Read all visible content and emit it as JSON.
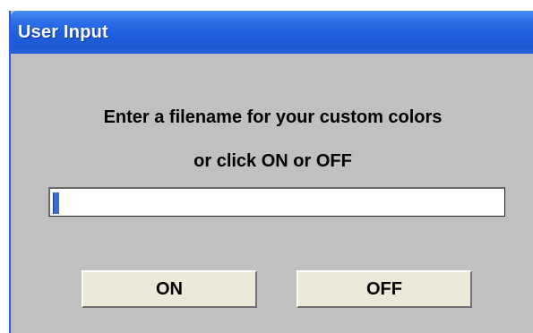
{
  "window": {
    "title": "User Input"
  },
  "dialog": {
    "prompt_line1": "Enter a filename for your custom colors",
    "prompt_line2": "or click ON or OFF",
    "filename_value": ""
  },
  "buttons": {
    "on_label": "ON",
    "off_label": "OFF"
  },
  "colors": {
    "titlebar": "#1f5fdc",
    "dialog_bg": "#c0c0c0",
    "button_face": "#ece9d8"
  }
}
